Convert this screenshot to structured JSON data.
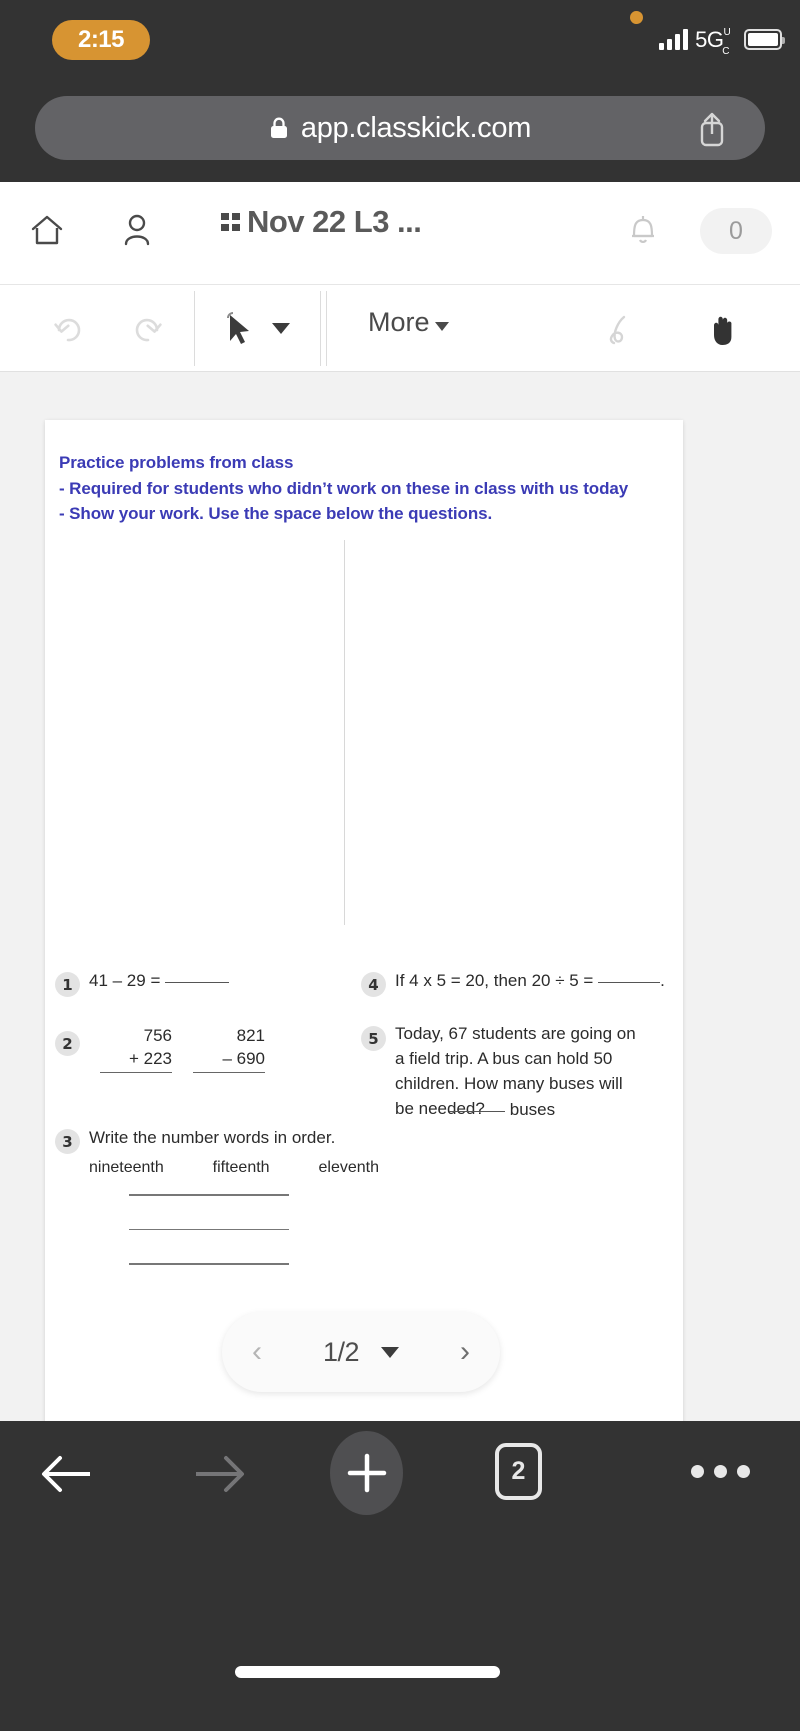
{
  "browser": {
    "status": {
      "time": "2:15",
      "network": "5G",
      "network_sup": "U",
      "network_sub": "C",
      "signal_icon": "signal-bars-icon",
      "battery_icon": "battery-icon",
      "recording_dot": "orange-status-dot"
    },
    "url": "app.classkick.com",
    "lock_icon": "lock-icon",
    "share_icon": "share-icon",
    "bottom": {
      "back_icon": "arrow-left-icon",
      "forward_icon": "arrow-right-icon",
      "new_tab_icon": "plus-icon",
      "tab_count": "2",
      "more_icon": "ellipsis-icon"
    }
  },
  "app_header": {
    "home_icon": "home-icon",
    "account_icon": "person-icon",
    "grid_icon": "grid-icon",
    "title": "Nov 22 L3 ...",
    "bell_icon": "bell-icon",
    "notification_count": "0"
  },
  "toolbar": {
    "undo_icon": "undo-icon",
    "redo_icon": "redo-icon",
    "select_icon": "cursor-arrow-icon",
    "select_caret_icon": "chevron-down-icon",
    "more_label": "More",
    "more_caret_icon": "chevron-down-icon",
    "pen_icon": "pen-icon",
    "hand_icon": "hand-icon"
  },
  "worksheet": {
    "header_lines": [
      "Practice problems from class",
      "- Required for students who didn’t work on these in class with us today",
      "- Show your work. Use the space below the questions."
    ],
    "header_color": "#3b3bb5",
    "problems": {
      "p1": {
        "num": "1",
        "text": "41 – 29 = "
      },
      "p2": {
        "num": "2",
        "stack_a": {
          "top": "756",
          "bottom": "+ 223"
        },
        "stack_b": {
          "top": "821",
          "bottom": "– 690"
        }
      },
      "p3": {
        "num": "3",
        "text": "Write the number words in order.",
        "words": [
          "nineteenth",
          "fifteenth",
          "eleventh"
        ],
        "answer_lines": 3
      },
      "p4": {
        "num": "4",
        "text_before": "If 4 x 5 = 20, then 20 ÷ 5 = ",
        "text_after": "."
      },
      "p5": {
        "num": "5",
        "text": "Today, 67 students are going on a field trip. A bus can hold 50 children. How many buses will be needed?",
        "answer_unit": "buses"
      }
    }
  },
  "pager": {
    "prev_icon": "chevron-left-icon",
    "label": "1/2",
    "caret_icon": "chevron-down-icon",
    "next_icon": "chevron-right-icon"
  }
}
